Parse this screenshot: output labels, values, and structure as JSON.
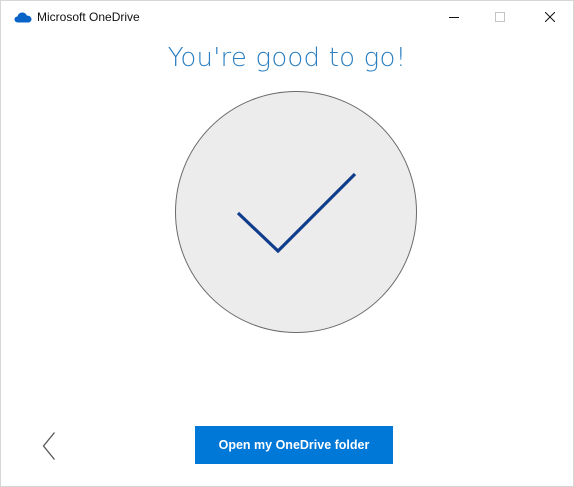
{
  "window": {
    "title": "Microsoft OneDrive",
    "app_icon": "onedrive-cloud-icon",
    "controls": {
      "minimize_icon": "minimize-icon",
      "maximize_icon": "maximize-icon",
      "close_icon": "close-icon"
    }
  },
  "main": {
    "heading": "You're good to go!",
    "hero_icon": "checkmark-icon",
    "back_icon": "chevron-left-icon",
    "primary_button_label": "Open my OneDrive folder"
  },
  "colors": {
    "accent": "#0078d7",
    "heading": "#2b7fc1",
    "checkmark": "#103c8c",
    "circle_fill": "#ececec",
    "circle_stroke": "#6b6b6b",
    "cloud_icon": "#0a64c8"
  }
}
